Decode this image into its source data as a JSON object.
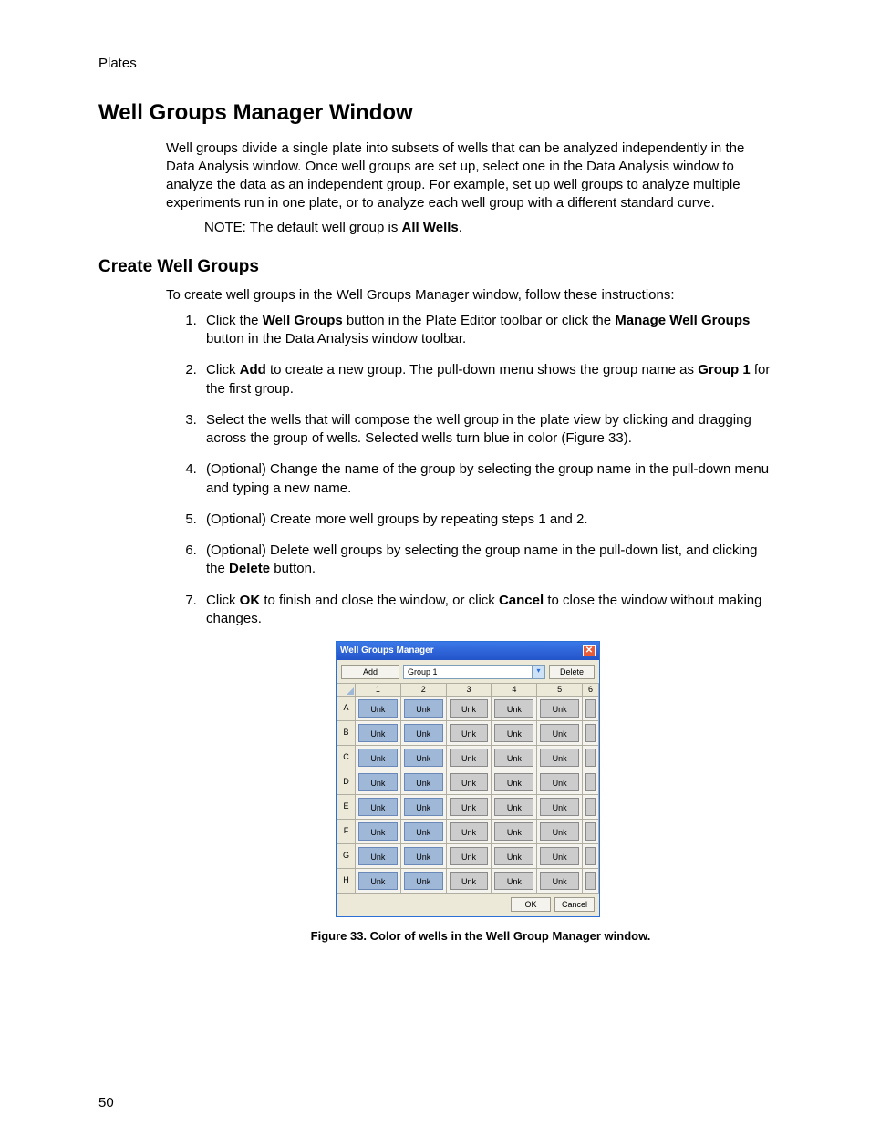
{
  "header": {
    "section": "Plates"
  },
  "h1": "Well Groups Manager Window",
  "intro_parts": {
    "p1": "Well groups divide a single plate into subsets of wells that can be analyzed independently in the Data Analysis window. Once well groups are set up, select one in the Data Analysis window to analyze the data as an independent group. For example, set up well groups to analyze multiple experiments run in one plate, or to analyze each well group with a different standard curve."
  },
  "note": {
    "pre": "NOTE: The default well group is ",
    "bold": "All Wells",
    "post": "."
  },
  "h2": "Create Well Groups",
  "lead": "To create well groups in the Well Groups Manager window, follow these instructions:",
  "steps": {
    "s1a": "Click the ",
    "s1b": "Well Groups",
    "s1c": " button in the Plate Editor toolbar or click the ",
    "s1d": "Manage Well Groups",
    "s1e": " button in the Data Analysis window toolbar.",
    "s2a": "Click ",
    "s2b": "Add",
    "s2c": " to create a new group. The pull-down menu shows the group name as ",
    "s2d": "Group 1",
    "s2e": " for the first group.",
    "s3": "Select the wells that will compose the well group in the plate view by clicking and dragging across the group of wells. Selected wells turn blue in color (Figure 33).",
    "s4": "(Optional) Change the name of the group by selecting the group name in the pull-down menu and typing a new name.",
    "s5": "(Optional) Create more well groups by repeating steps 1 and 2.",
    "s6a": "(Optional) Delete well groups by selecting the group name in the pull-down list, and clicking the ",
    "s6b": "Delete",
    "s6c": " button.",
    "s7a": "Click ",
    "s7b": "OK",
    "s7c": " to finish and close the window, or click ",
    "s7d": "Cancel",
    "s7e": " to close the window without making changes."
  },
  "window": {
    "title": "Well Groups Manager",
    "close": "✕",
    "add": "Add",
    "delete": "Delete",
    "group": "Group 1",
    "arrow": "▾",
    "cols": [
      "1",
      "2",
      "3",
      "4",
      "5",
      "6"
    ],
    "rows": [
      "A",
      "B",
      "C",
      "D",
      "E",
      "F",
      "G",
      "H"
    ],
    "cell": "Unk",
    "ok": "OK",
    "cancel": "Cancel"
  },
  "caption": "Figure 33. Color of wells in the Well Group Manager window.",
  "page": "50"
}
